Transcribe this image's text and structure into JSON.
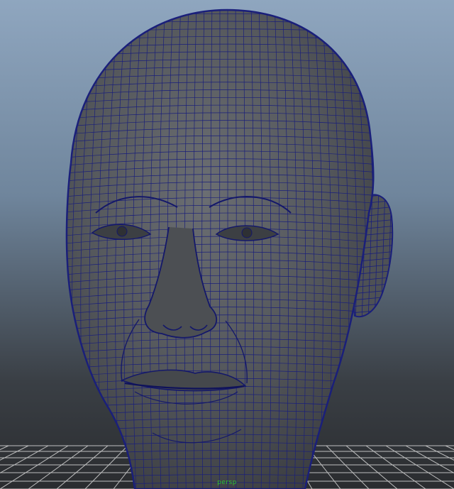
{
  "viewport": {
    "camera_label": "persp",
    "colors": {
      "background_top": "#8fa6bf",
      "background_bottom": "#2a2c2f",
      "mesh_fill": "#55585c",
      "wireframe": "#1a1f7a",
      "ground_grid": "#d8d8d8"
    },
    "object": "head-mesh",
    "display_mode": "wireframe-on-shaded",
    "ground_grid_visible": true
  }
}
